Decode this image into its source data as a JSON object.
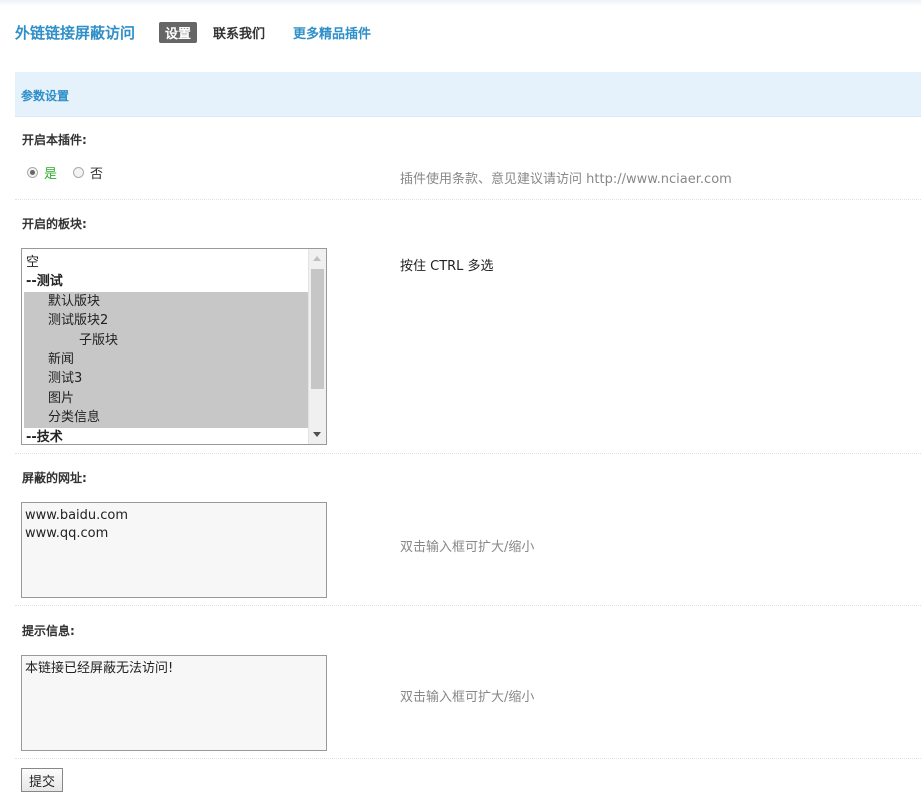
{
  "header": {
    "title": "外链链接屏蔽访问",
    "tabs": [
      {
        "label": "设置",
        "active": true
      },
      {
        "label": "联系我们",
        "active": false
      }
    ],
    "more_link": "更多精品插件"
  },
  "section": {
    "title": "参数设置"
  },
  "enable_plugin": {
    "label": "开启本插件:",
    "options": [
      {
        "label": "是",
        "checked": true
      },
      {
        "label": "否",
        "checked": false
      }
    ],
    "note": "插件使用条款、意见建议请访问 http://www.nciaer.com"
  },
  "forums": {
    "label": "开启的板块:",
    "note": "按住 CTRL 多选",
    "options": [
      {
        "text": "空",
        "level": 1,
        "group": false,
        "selected": false
      },
      {
        "text": "--测试",
        "level": 1,
        "group": true,
        "selected": false
      },
      {
        "text": "默认版块",
        "level": 2,
        "group": false,
        "selected": true
      },
      {
        "text": "测试版块2",
        "level": 2,
        "group": false,
        "selected": true
      },
      {
        "text": "子版块",
        "level": 3,
        "group": false,
        "selected": true
      },
      {
        "text": "新闻",
        "level": 2,
        "group": false,
        "selected": true
      },
      {
        "text": "测试3",
        "level": 2,
        "group": false,
        "selected": true
      },
      {
        "text": "图片",
        "level": 2,
        "group": false,
        "selected": true
      },
      {
        "text": "分类信息",
        "level": 2,
        "group": false,
        "selected": true
      },
      {
        "text": "--技术",
        "level": 1,
        "group": true,
        "selected": false
      }
    ]
  },
  "blocked_urls": {
    "label": "屏蔽的网址:",
    "value": "www.baidu.com\nwww.qq.com",
    "note": "双击输入框可扩大/缩小"
  },
  "message": {
    "label": "提示信息:",
    "value": "本链接已经屏蔽无法访问!",
    "note": "双击输入框可扩大/缩小"
  },
  "submit_label": "提交"
}
